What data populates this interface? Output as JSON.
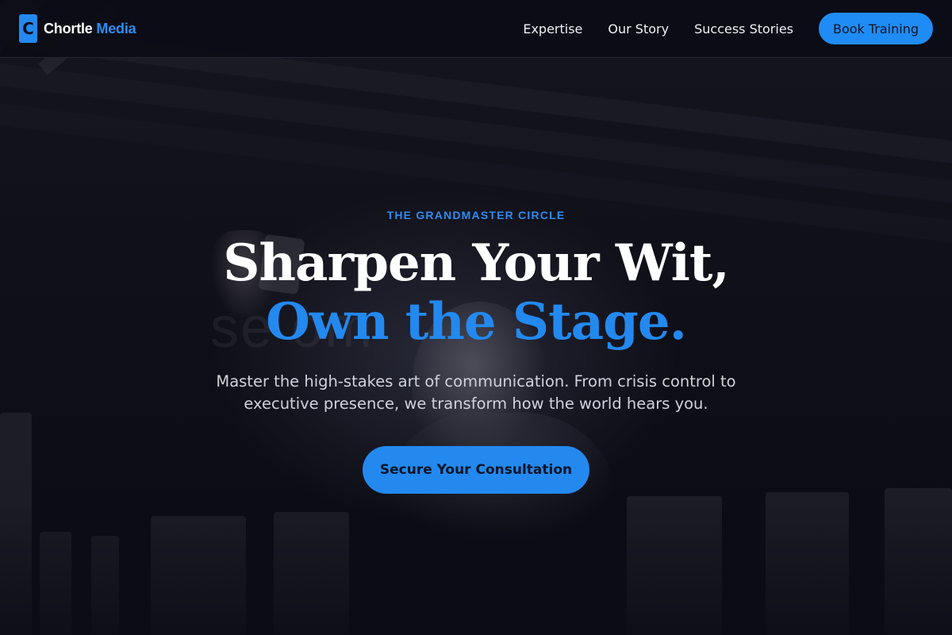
{
  "brand": {
    "logo_letter": "C",
    "name": "Chortle",
    "name_accent": "Media"
  },
  "nav": {
    "links": [
      {
        "label": "Expertise"
      },
      {
        "label": "Our Story"
      },
      {
        "label": "Success Stories"
      }
    ],
    "cta_label": "Book Training"
  },
  "hero": {
    "eyebrow": "THE GRANDMASTER CIRCLE",
    "headline_line1": "Sharpen Your Wit,",
    "headline_line2": "Own the Stage.",
    "subtext": "Master the high-stakes art of communication. From crisis control to executive presence, we transform how the world hears you.",
    "cta_label": "Secure Your Consultation",
    "background_text": "se om"
  },
  "colors": {
    "accent": "#2389ef",
    "background": "#0c0c16",
    "heading": "#ffffff",
    "body_text": "#cfd2dc"
  },
  "icons": [
    "logo-badge-icon"
  ]
}
